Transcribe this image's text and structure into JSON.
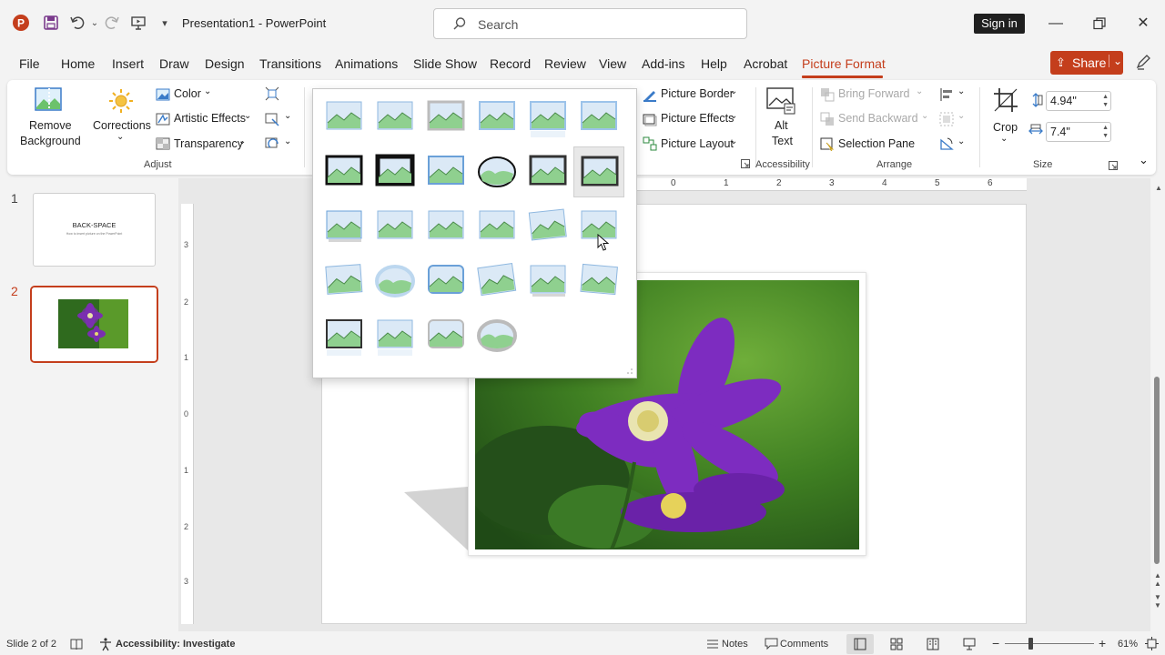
{
  "titlebar": {
    "title": "Presentation1  -  PowerPoint",
    "search_placeholder": "Search",
    "sign_in": "Sign in",
    "app_icon_letter": "P",
    "colors": {
      "accent": "#c43e1c"
    }
  },
  "menu": {
    "tabs": [
      "File",
      "Home",
      "Insert",
      "Draw",
      "Design",
      "Transitions",
      "Animations",
      "Slide Show",
      "Record",
      "Review",
      "View",
      "Add-ins",
      "Help",
      "Acrobat",
      "Picture Format"
    ],
    "active_tab": "Picture Format",
    "share": "Share"
  },
  "ribbon": {
    "adjust": {
      "remove_background_1": "Remove",
      "remove_background_2": "Background",
      "corrections": "Corrections",
      "color": "Color",
      "artistic_effects": "Artistic Effects",
      "transparency": "Transparency",
      "group_label": "Adjust"
    },
    "picture_styles": {
      "picture_border": "Picture Border",
      "picture_effects": "Picture Effects",
      "picture_layout": "Picture Layout"
    },
    "accessibility": {
      "alt_text_1": "Alt",
      "alt_text_2": "Text",
      "group_label": "Accessibility"
    },
    "arrange": {
      "bring_forward": "Bring Forward",
      "send_backward": "Send Backward",
      "selection_pane": "Selection Pane",
      "group_label": "Arrange"
    },
    "size": {
      "crop": "Crop",
      "height": "4.94\"",
      "width": "7.4\"",
      "group_label": "Size"
    }
  },
  "slides_pane": {
    "slides": [
      {
        "number": "1",
        "title": "BACK-SPACE",
        "subtitle": "How to insert picture on the PowerPoint"
      },
      {
        "number": "2"
      }
    ],
    "selected": "2"
  },
  "ruler": {
    "h_ticks": [
      "0",
      "1",
      "2",
      "3",
      "4",
      "5",
      "6"
    ],
    "v_ticks": [
      "3",
      "2",
      "1",
      "0",
      "1",
      "2",
      "3"
    ]
  },
  "gallery": {
    "rows": 5,
    "columns": 6,
    "item_count": 28,
    "hovered_index": 11
  },
  "statusbar": {
    "slide_info": "Slide 2 of 2",
    "accessibility": "Accessibility: Investigate",
    "notes": "Notes",
    "comments": "Comments",
    "zoom": "61%"
  }
}
